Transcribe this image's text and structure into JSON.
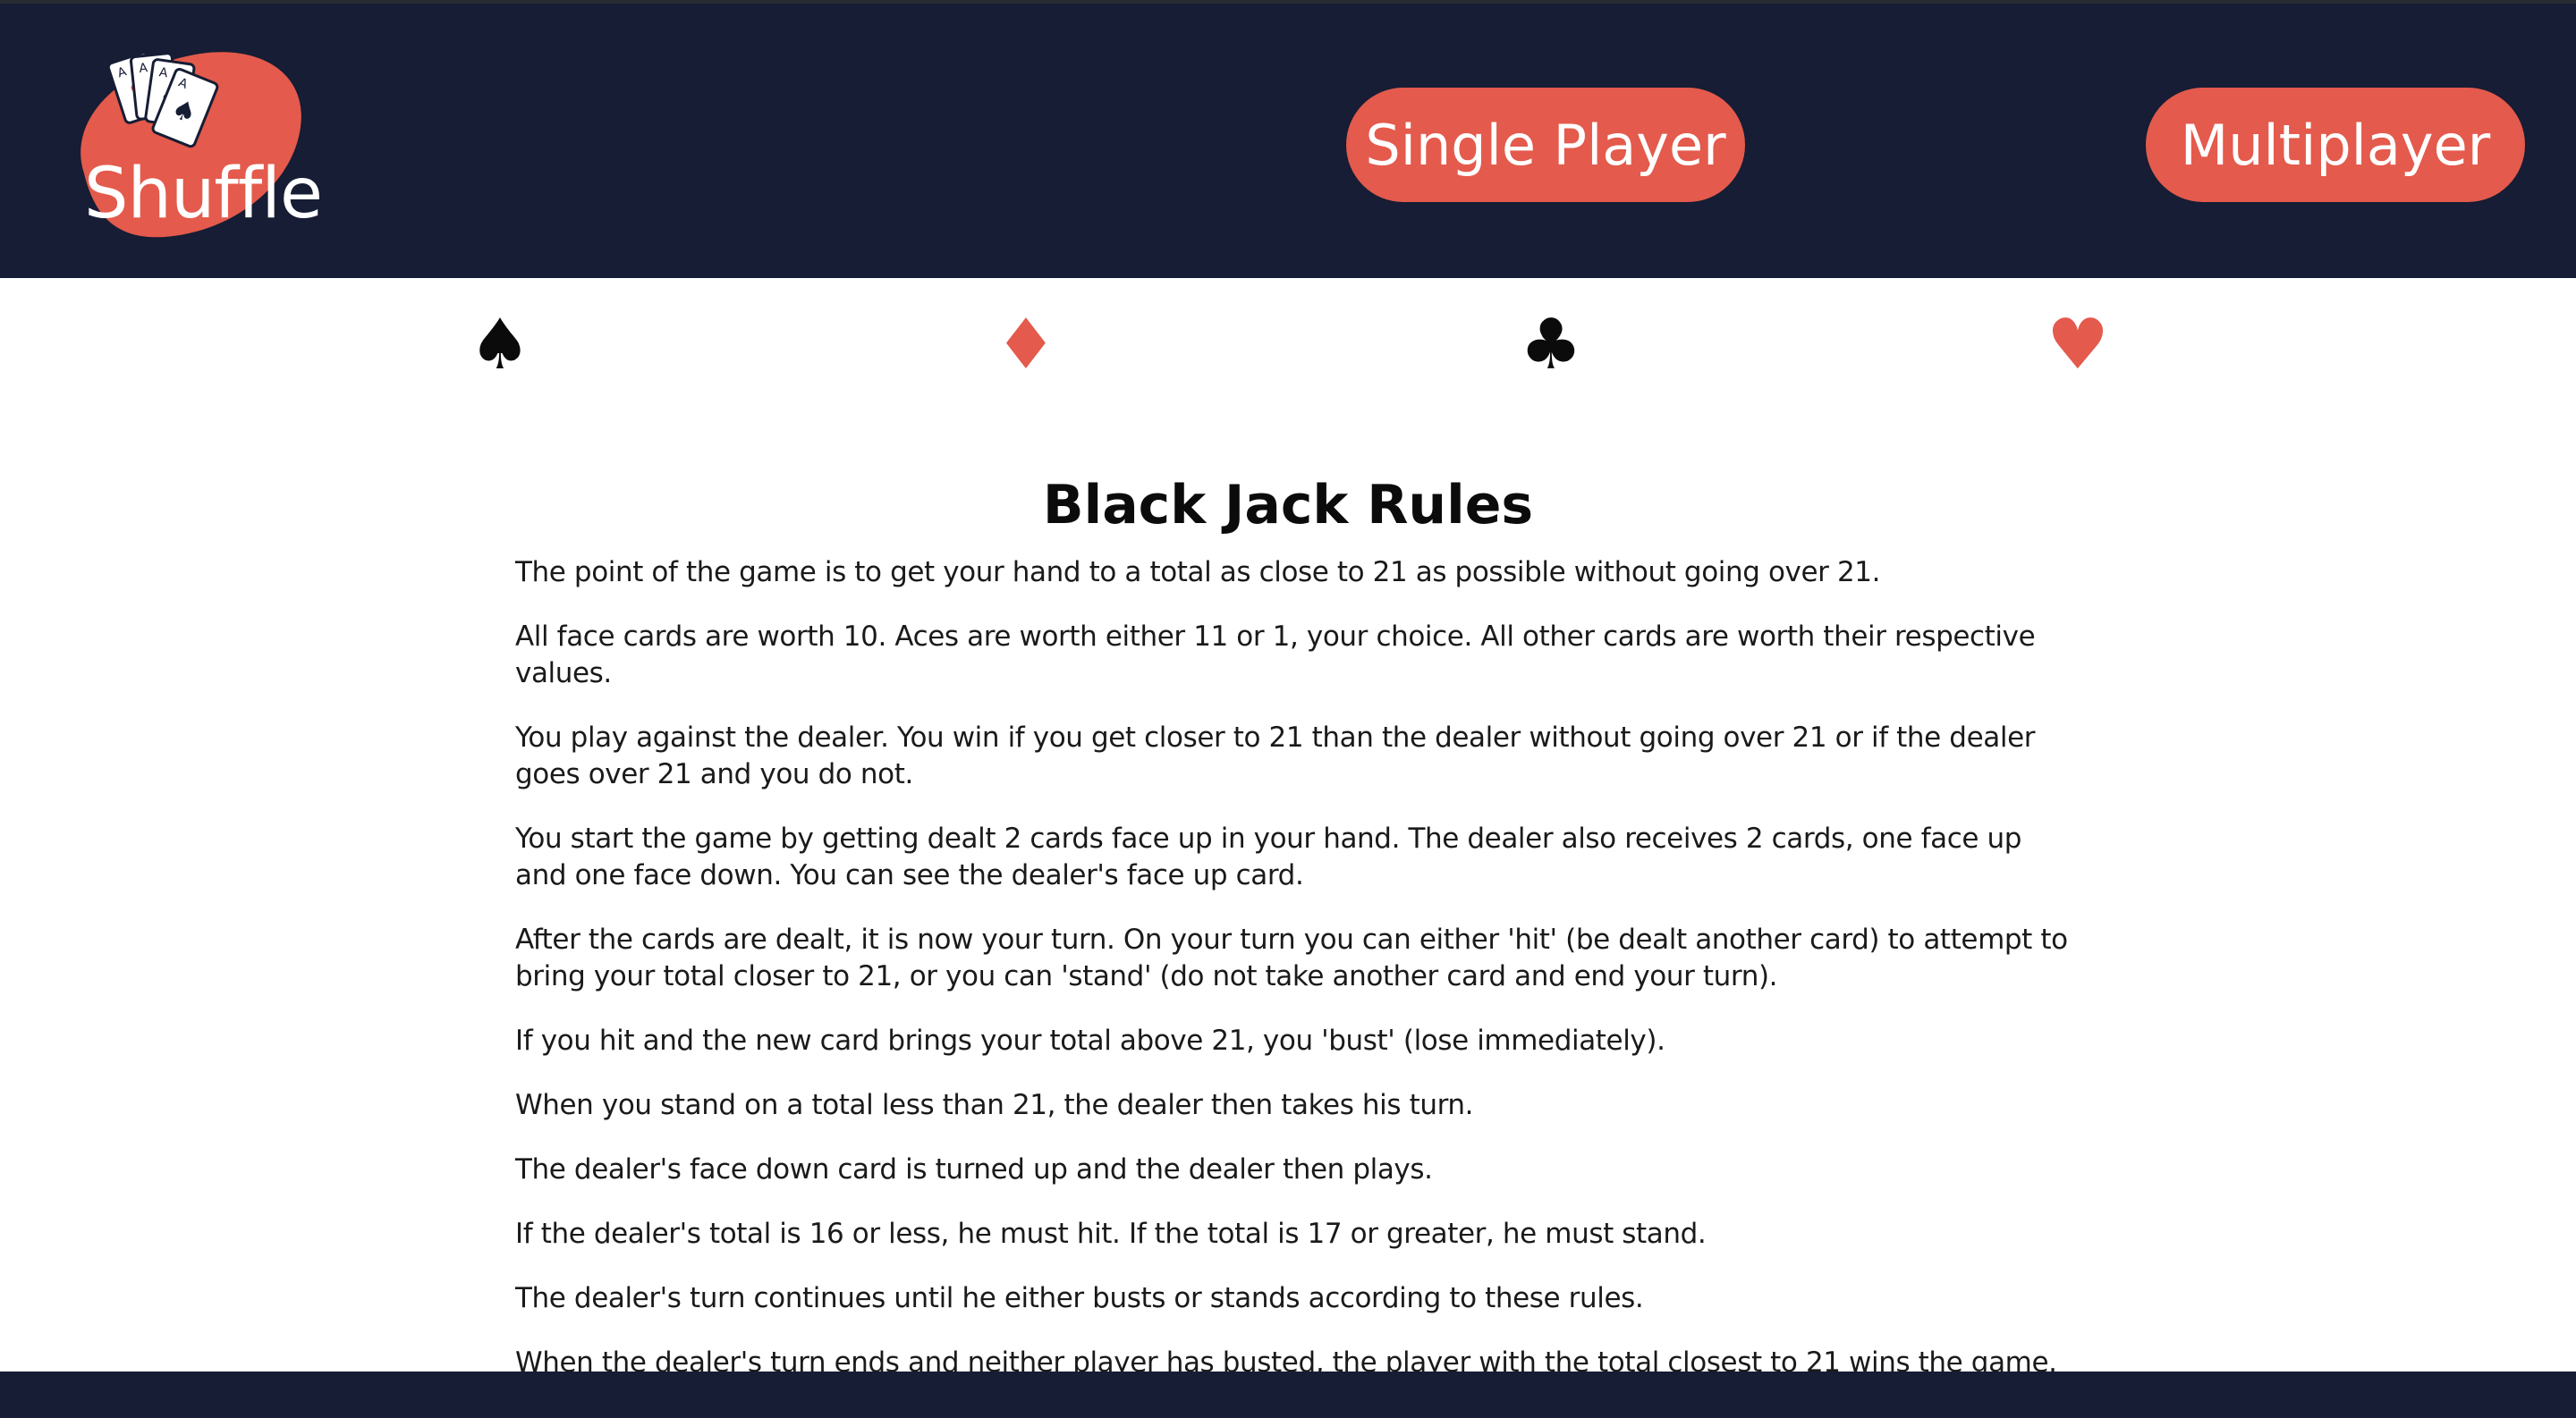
{
  "brand": {
    "logo_text": "Shuffle",
    "colors": {
      "navy": "#161d34",
      "coral": "#e45a4c",
      "white": "#ffffff",
      "black": "#0b0b0b"
    }
  },
  "nav": {
    "single_player_label": "Single Player",
    "multiplayer_label": "Multiplayer"
  },
  "suits": {
    "spade": "♠",
    "diamond": "♦",
    "club": "♣",
    "heart": "♥"
  },
  "icons": [
    "playing-cards-icon",
    "spade-icon",
    "diamond-icon",
    "club-icon",
    "heart-icon"
  ],
  "content": {
    "title": "Black Jack Rules",
    "rules": [
      "The point of the game is to get your hand to a total as close to 21 as possible without going over 21.",
      "All face cards are worth 10. Aces are worth either 11 or 1, your choice. All other cards are worth their respective values.",
      "You play against the dealer. You win if you get closer to 21 than the dealer without going over 21 or if the dealer goes over 21 and you do not.",
      "You start the game by getting dealt 2 cards face up in your hand. The dealer also receives 2 cards, one face up and one face down. You can see the dealer's face up card.",
      "After the cards are dealt, it is now your turn. On your turn you can either 'hit' (be dealt another card) to attempt to bring your total closer to 21, or you can 'stand' (do not take another card and end your turn).",
      "If you hit and the new card brings your total above 21, you 'bust' (lose immediately).",
      "When you stand on a total less than 21, the dealer then takes his turn.",
      "The dealer's face down card is turned up and the dealer then plays.",
      "If the dealer's total is 16 or less, he must hit. If the total is 17 or greater, he must stand.",
      "The dealer's turn continues until he either busts or stands according to these rules.",
      "When the dealer's turn ends and neither player has busted, the player with the total closest to 21 wins the game."
    ]
  }
}
